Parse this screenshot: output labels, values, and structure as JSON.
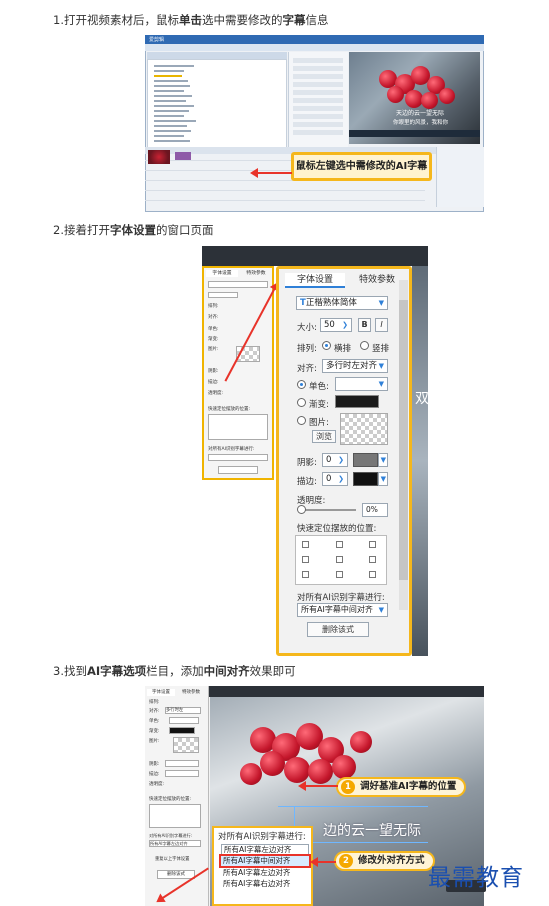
{
  "steps": [
    {
      "number": "1.",
      "pre": "打开视频素材后，鼠标",
      "bold1": "单击",
      "mid": "选中需要修改的",
      "bold2": "字幕",
      "post": "信息"
    },
    {
      "number": "2.",
      "pre": "接着打开",
      "bold1": "字体设置",
      "post": "的窗口页面"
    },
    {
      "number": "3.",
      "pre": "找到",
      "bold1": "AI字幕选项",
      "mid": "栏目，添加",
      "bold2": "中间对齐",
      "post": "效果即可"
    }
  ],
  "shot1": {
    "app_title": "爱剪辑",
    "subtitle_line1": "天边的云一望无际",
    "subtitle_line2": "你眼里的风景，我和你",
    "callout": "鼠标左键选中需修改的AI字幕"
  },
  "shot2": {
    "tabs": [
      "字体设置",
      "特效参数"
    ],
    "font_name": "正楷熟体简体",
    "size_label": "大小:",
    "size_value": "50",
    "bold_label": "B",
    "italic_label": "I",
    "layout_label": "排列:",
    "layout_options": [
      "横排",
      "竖排"
    ],
    "align_label": "对齐:",
    "align_value": "多行时左对齐",
    "color_single": "单色:",
    "color_gradient": "渐变:",
    "color_image": "图片:",
    "browse_button": "浏览",
    "shadow_label": "阴影:",
    "shadow_value": "0",
    "stroke_label": "描边:",
    "stroke_value": "0",
    "opacity_label": "透明度:",
    "opacity_value": "0%",
    "position_label": "快速定位摆放的位置:",
    "ai_label": "对所有AI识别字幕进行:",
    "ai_value": "所有AI字幕中间对齐",
    "apply_button": "删除该式",
    "preview_text": "双"
  },
  "shot3": {
    "ai_label": "对所有AI识别字幕进行:",
    "current_value": "所有AI字幕左边对齐",
    "options": [
      "所有AI字幕中间对齐",
      "所有AI字幕左边对齐",
      "所有AI字幕右边对齐"
    ],
    "subtitle": "边的云一望无际",
    "pill1_num": "1",
    "pill1_text": "调好基准AI字幕的位置",
    "pill2_num": "2",
    "pill2_text": "修改外对齐方式",
    "left_labels": [
      "排列:",
      "对齐:",
      "单色:",
      "渐变:",
      "图片:",
      "阴影:",
      "描边:",
      "透明度:",
      "快速定位摆放的位置:",
      "对所有AI识别字幕进行:",
      "重复以上字体设置",
      "删除该式"
    ],
    "left_align_value": "多行时左",
    "left_ai_value": "所有AI字幕左边对齐",
    "watermark": "最需教育"
  },
  "colors": {
    "accent": "#f5b71c",
    "arrow": "#e8332a",
    "tab_blue": "#2f80d8"
  }
}
